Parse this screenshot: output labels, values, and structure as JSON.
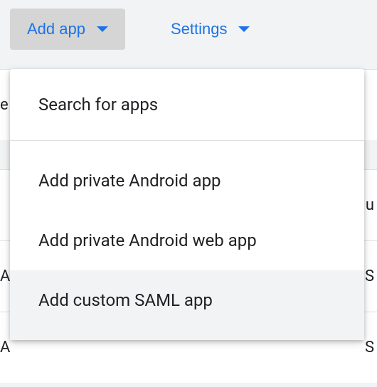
{
  "toolbar": {
    "add_app_label": "Add app",
    "settings_label": "Settings"
  },
  "menu": {
    "search_label": "Search for apps",
    "add_private_android_label": "Add private Android app",
    "add_private_android_web_label": "Add private Android web app",
    "add_custom_saml_label": "Add custom SAML app"
  },
  "bg": {
    "row1_left": "e",
    "row2_right": "u",
    "row3_left": "A",
    "row3_right": "S",
    "row4_left": "A",
    "row4_right": "S"
  }
}
